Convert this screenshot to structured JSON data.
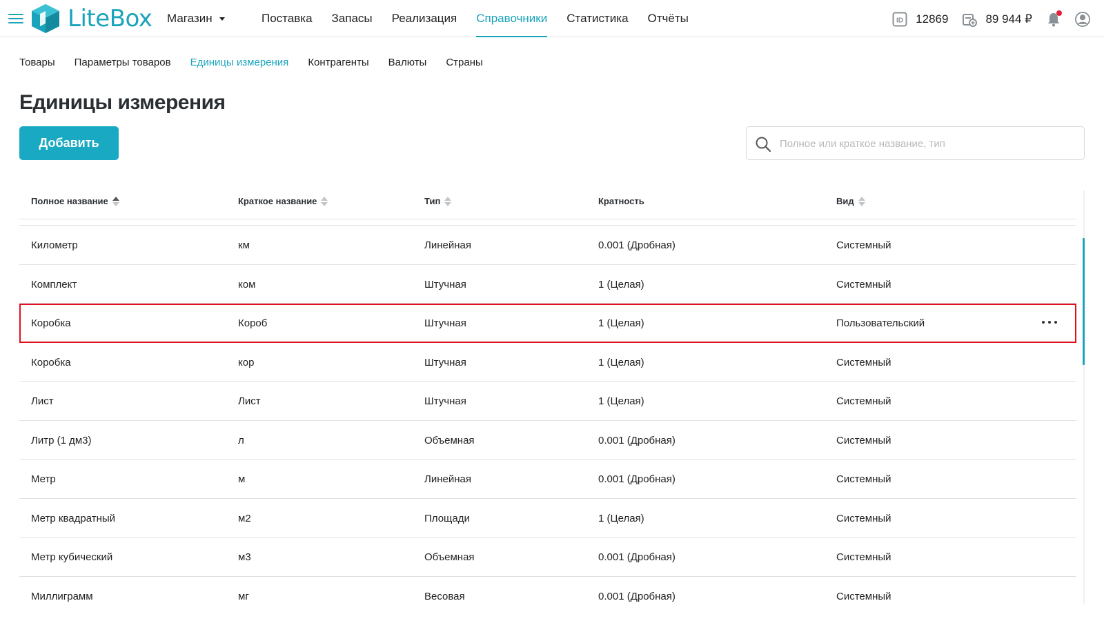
{
  "header": {
    "logo_text": "LiteBox",
    "store_label": "Магазин",
    "nav": [
      {
        "label": "Поставка"
      },
      {
        "label": "Запасы"
      },
      {
        "label": "Реализация"
      },
      {
        "label": "Справочники",
        "active": true
      },
      {
        "label": "Статистика"
      },
      {
        "label": "Отчёты"
      }
    ],
    "account_id": "12869",
    "balance": "89 944 ₽",
    "icons": [
      "menu-icon",
      "id-icon",
      "wallet-icon",
      "bell-icon",
      "user-icon"
    ],
    "accent_color": "#1aa4bb"
  },
  "subnav": [
    {
      "label": "Товары"
    },
    {
      "label": "Параметры товаров"
    },
    {
      "label": "Единицы измерения",
      "active": true
    },
    {
      "label": "Контрагенты"
    },
    {
      "label": "Валюты"
    },
    {
      "label": "Страны"
    }
  ],
  "page": {
    "title": "Единицы измерения",
    "add_button": "Добавить",
    "search_placeholder": "Полное или краткое название, тип"
  },
  "table": {
    "columns": [
      {
        "label": "Полное название",
        "sortable": true,
        "sorted": "asc"
      },
      {
        "label": "Краткое название",
        "sortable": true
      },
      {
        "label": "Тип",
        "sortable": true
      },
      {
        "label": "Кратность",
        "sortable": false
      },
      {
        "label": "Вид",
        "sortable": true
      }
    ],
    "rows": [
      [
        "Километр",
        "км",
        "Линейная",
        "0.001 (Дробная)",
        "Системный"
      ],
      [
        "Комплект",
        "ком",
        "Штучная",
        "1 (Целая)",
        "Системный"
      ],
      [
        "Коробка",
        "Короб",
        "Штучная",
        "1 (Целая)",
        "Пользовательский"
      ],
      [
        "Коробка",
        "кор",
        "Штучная",
        "1 (Целая)",
        "Системный"
      ],
      [
        "Лист",
        "Лист",
        "Штучная",
        "1 (Целая)",
        "Системный"
      ],
      [
        "Литр (1 дм3)",
        "л",
        "Объемная",
        "0.001 (Дробная)",
        "Системный"
      ],
      [
        "Метр",
        "м",
        "Линейная",
        "0.001 (Дробная)",
        "Системный"
      ],
      [
        "Метр квадратный",
        "м2",
        "Площади",
        "1 (Целая)",
        "Системный"
      ],
      [
        "Метр кубический",
        "м3",
        "Объемная",
        "0.001 (Дробная)",
        "Системный"
      ],
      [
        "Миллиграмм",
        "мг",
        "Весовая",
        "0.001 (Дробная)",
        "Системный"
      ]
    ],
    "highlighted_row": 2,
    "highlight_color": "#e0101f"
  }
}
